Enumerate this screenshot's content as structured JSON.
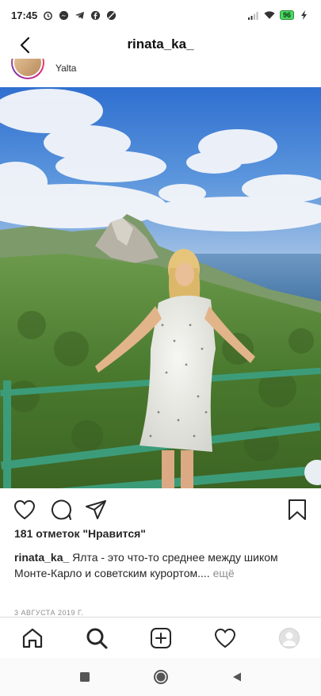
{
  "status_bar": {
    "time": "17:45",
    "left_icons": [
      "alarm-icon",
      "messenger-icon",
      "telegram-icon",
      "facebook-icon",
      "vpn-icon"
    ],
    "right_icons": [
      "signal-icon",
      "wifi-icon",
      "battery-icon",
      "charging-icon"
    ],
    "battery_level": "96"
  },
  "header": {
    "title": "rinata_ka_",
    "back_icon": "chevron-left-icon"
  },
  "post": {
    "location": "Yalta",
    "likes_text": "181 отметок \"Нравится\"",
    "caption_user": "rinata_ka_",
    "caption_text": "Ялта - это что-то среднее между шиком Монте-Карло и советским курортом....",
    "more_label": "ещё",
    "date": "3 АВГУСТА 2019 Г."
  },
  "actions": [
    "heart-icon",
    "comment-icon",
    "share-icon",
    "bookmark-icon"
  ],
  "bottom_nav": [
    "home-icon",
    "search-icon",
    "add-post-icon",
    "activity-heart-icon",
    "profile-avatar"
  ],
  "system_nav": [
    "recent-apps-icon",
    "home-circle-icon",
    "back-triangle-icon"
  ],
  "colors": {
    "text": "#262626",
    "muted": "#8e8e8e",
    "divider": "#dbdbdb",
    "sky": "#3f7fd6",
    "sea": "#4d7fb0",
    "forest": "#4f7d33",
    "railing": "#3c9c7a"
  }
}
